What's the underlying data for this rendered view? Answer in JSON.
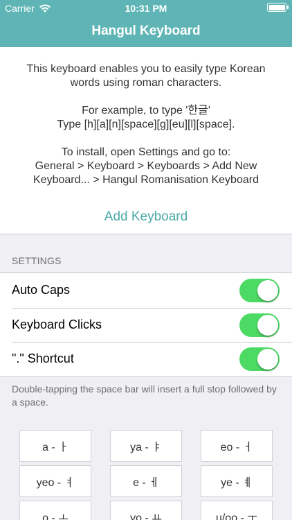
{
  "status_bar": {
    "carrier": "Carrier",
    "time": "10:31 PM",
    "wifi_icon": "wifi-icon",
    "battery_icon": "battery-icon"
  },
  "nav": {
    "title": "Hangul Keyboard"
  },
  "info": {
    "paragraph1": "This keyboard enables you to easily type Korean words using roman characters.",
    "paragraph2_line1": "For example, to type '한글'",
    "paragraph2_line2": "Type [h][a][n][space][g][eu][l][space].",
    "paragraph3_line1": "To install, open Settings and go to:",
    "paragraph3_line2": "General > Keyboard > Keyboards > Add New Keyboard... > Hangul Romanisation Keyboard",
    "add_button": "Add Keyboard"
  },
  "settings": {
    "header": "SETTINGS",
    "rows": [
      {
        "label": "Auto Caps",
        "on": true
      },
      {
        "label": "Keyboard Clicks",
        "on": true
      },
      {
        "label": "\".\" Shortcut",
        "on": true
      }
    ],
    "footer": "Double-tapping the space bar will insert a full stop followed by a space."
  },
  "keys": [
    "a - ㅏ",
    "ya - ㅑ",
    "eo - ㅓ",
    "yeo - ㅕ",
    "e - ㅔ",
    "ye - ㅖ",
    "o - ㅗ",
    "yo - ㅛ",
    "u/oo - ㅜ"
  ],
  "colors": {
    "accent": "#5fb5b5",
    "switch_on": "#4cd964"
  }
}
